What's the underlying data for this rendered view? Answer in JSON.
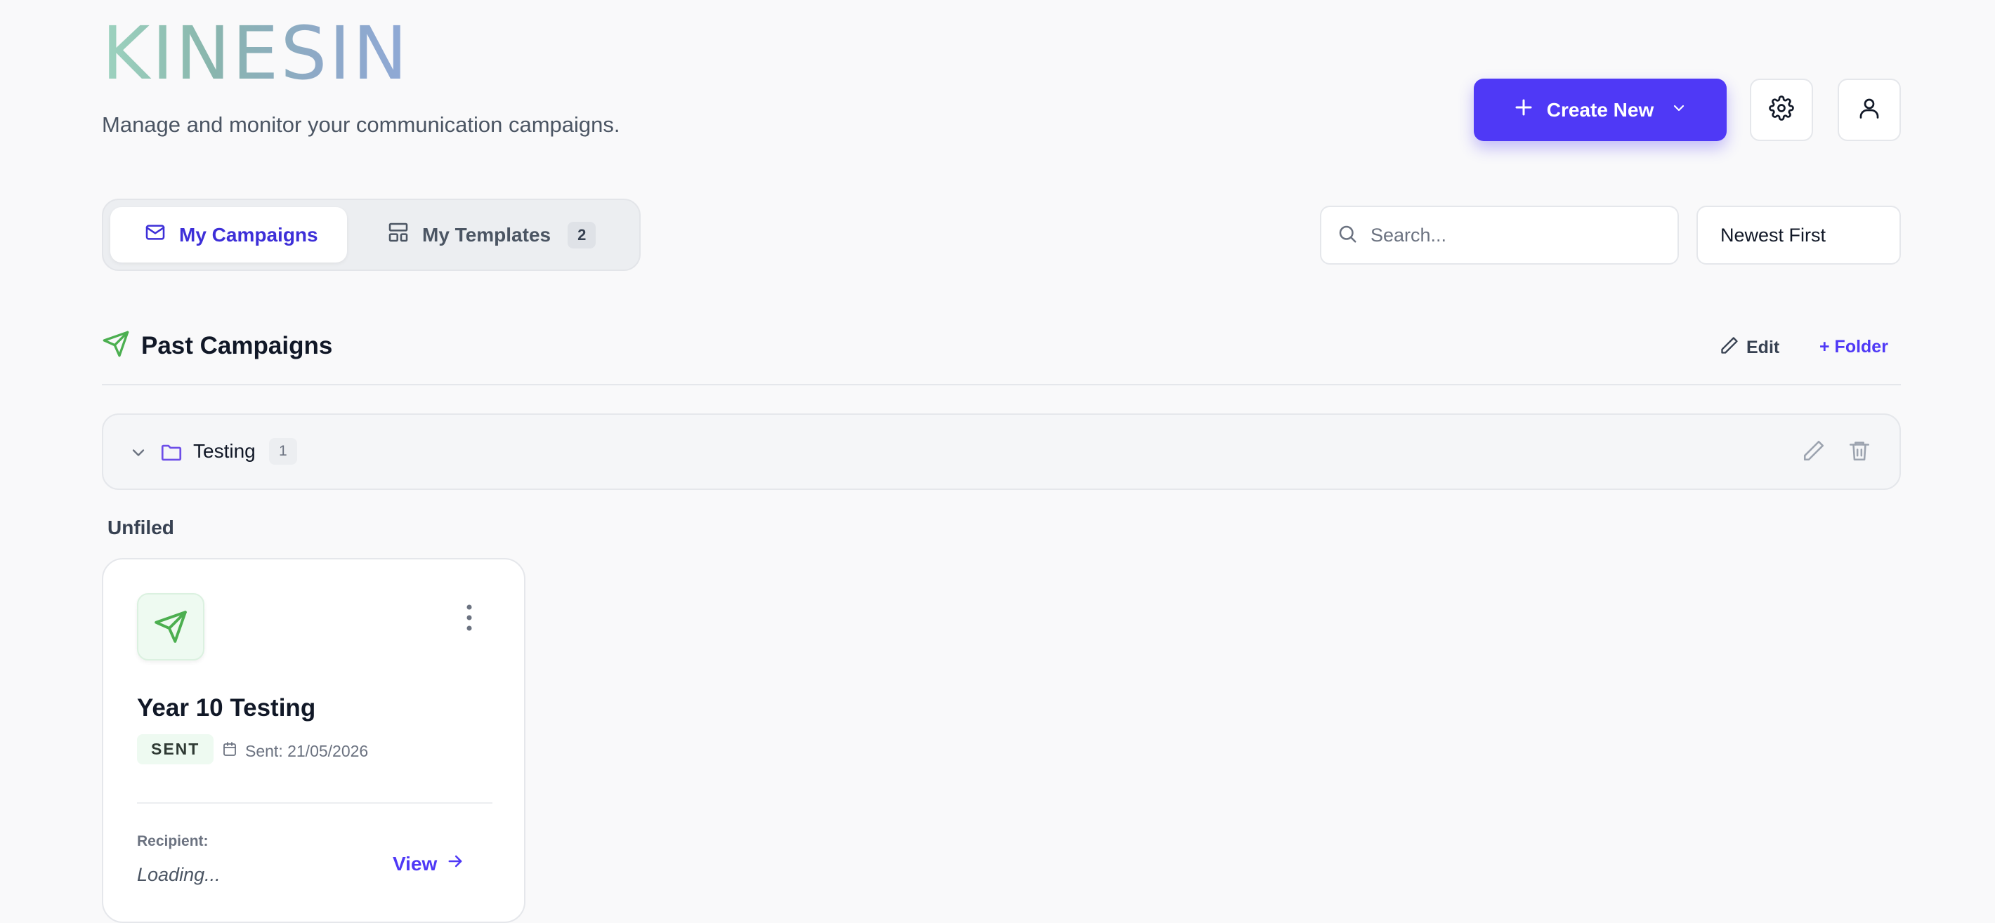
{
  "header": {
    "logo": "KINESIN",
    "subtitle": "Manage and monitor your communication campaigns.",
    "create_label": "Create New"
  },
  "tabs": [
    {
      "label": "My Campaigns",
      "active": true
    },
    {
      "label": "My Templates",
      "count": "2",
      "active": false
    }
  ],
  "search": {
    "placeholder": "Search..."
  },
  "sort": {
    "selected": "Newest First"
  },
  "section": {
    "title": "Past Campaigns",
    "edit_label": "Edit",
    "folder_label": "+ Folder"
  },
  "folders": [
    {
      "name": "Testing",
      "count": "1"
    }
  ],
  "unfiled_label": "Unfiled",
  "campaigns": [
    {
      "title": "Year 10 Testing",
      "status": "SENT",
      "sent_date": "Sent: 21/05/2026",
      "recipient_label": "Recipient:",
      "recipient_value": "Loading...",
      "view_label": "View"
    }
  ],
  "icons": {
    "create": "plus-icon",
    "create_dropdown": "chevron-down-icon",
    "settings": "gear-icon",
    "profile": "user-icon",
    "campaigns_tab": "mail-icon",
    "templates_tab": "layout-icon",
    "search": "search-icon",
    "section": "send-icon",
    "edit": "pencil-icon",
    "folder_toggle": "chevron-down-icon",
    "folder": "folder-icon",
    "delete": "trash-icon",
    "card_menu": "more-vertical-icon",
    "calendar": "calendar-icon",
    "view": "arrow-right-icon"
  },
  "colors": {
    "accent": "#4f39f6",
    "success": "#4caf50",
    "background": "#f9f9fa"
  }
}
